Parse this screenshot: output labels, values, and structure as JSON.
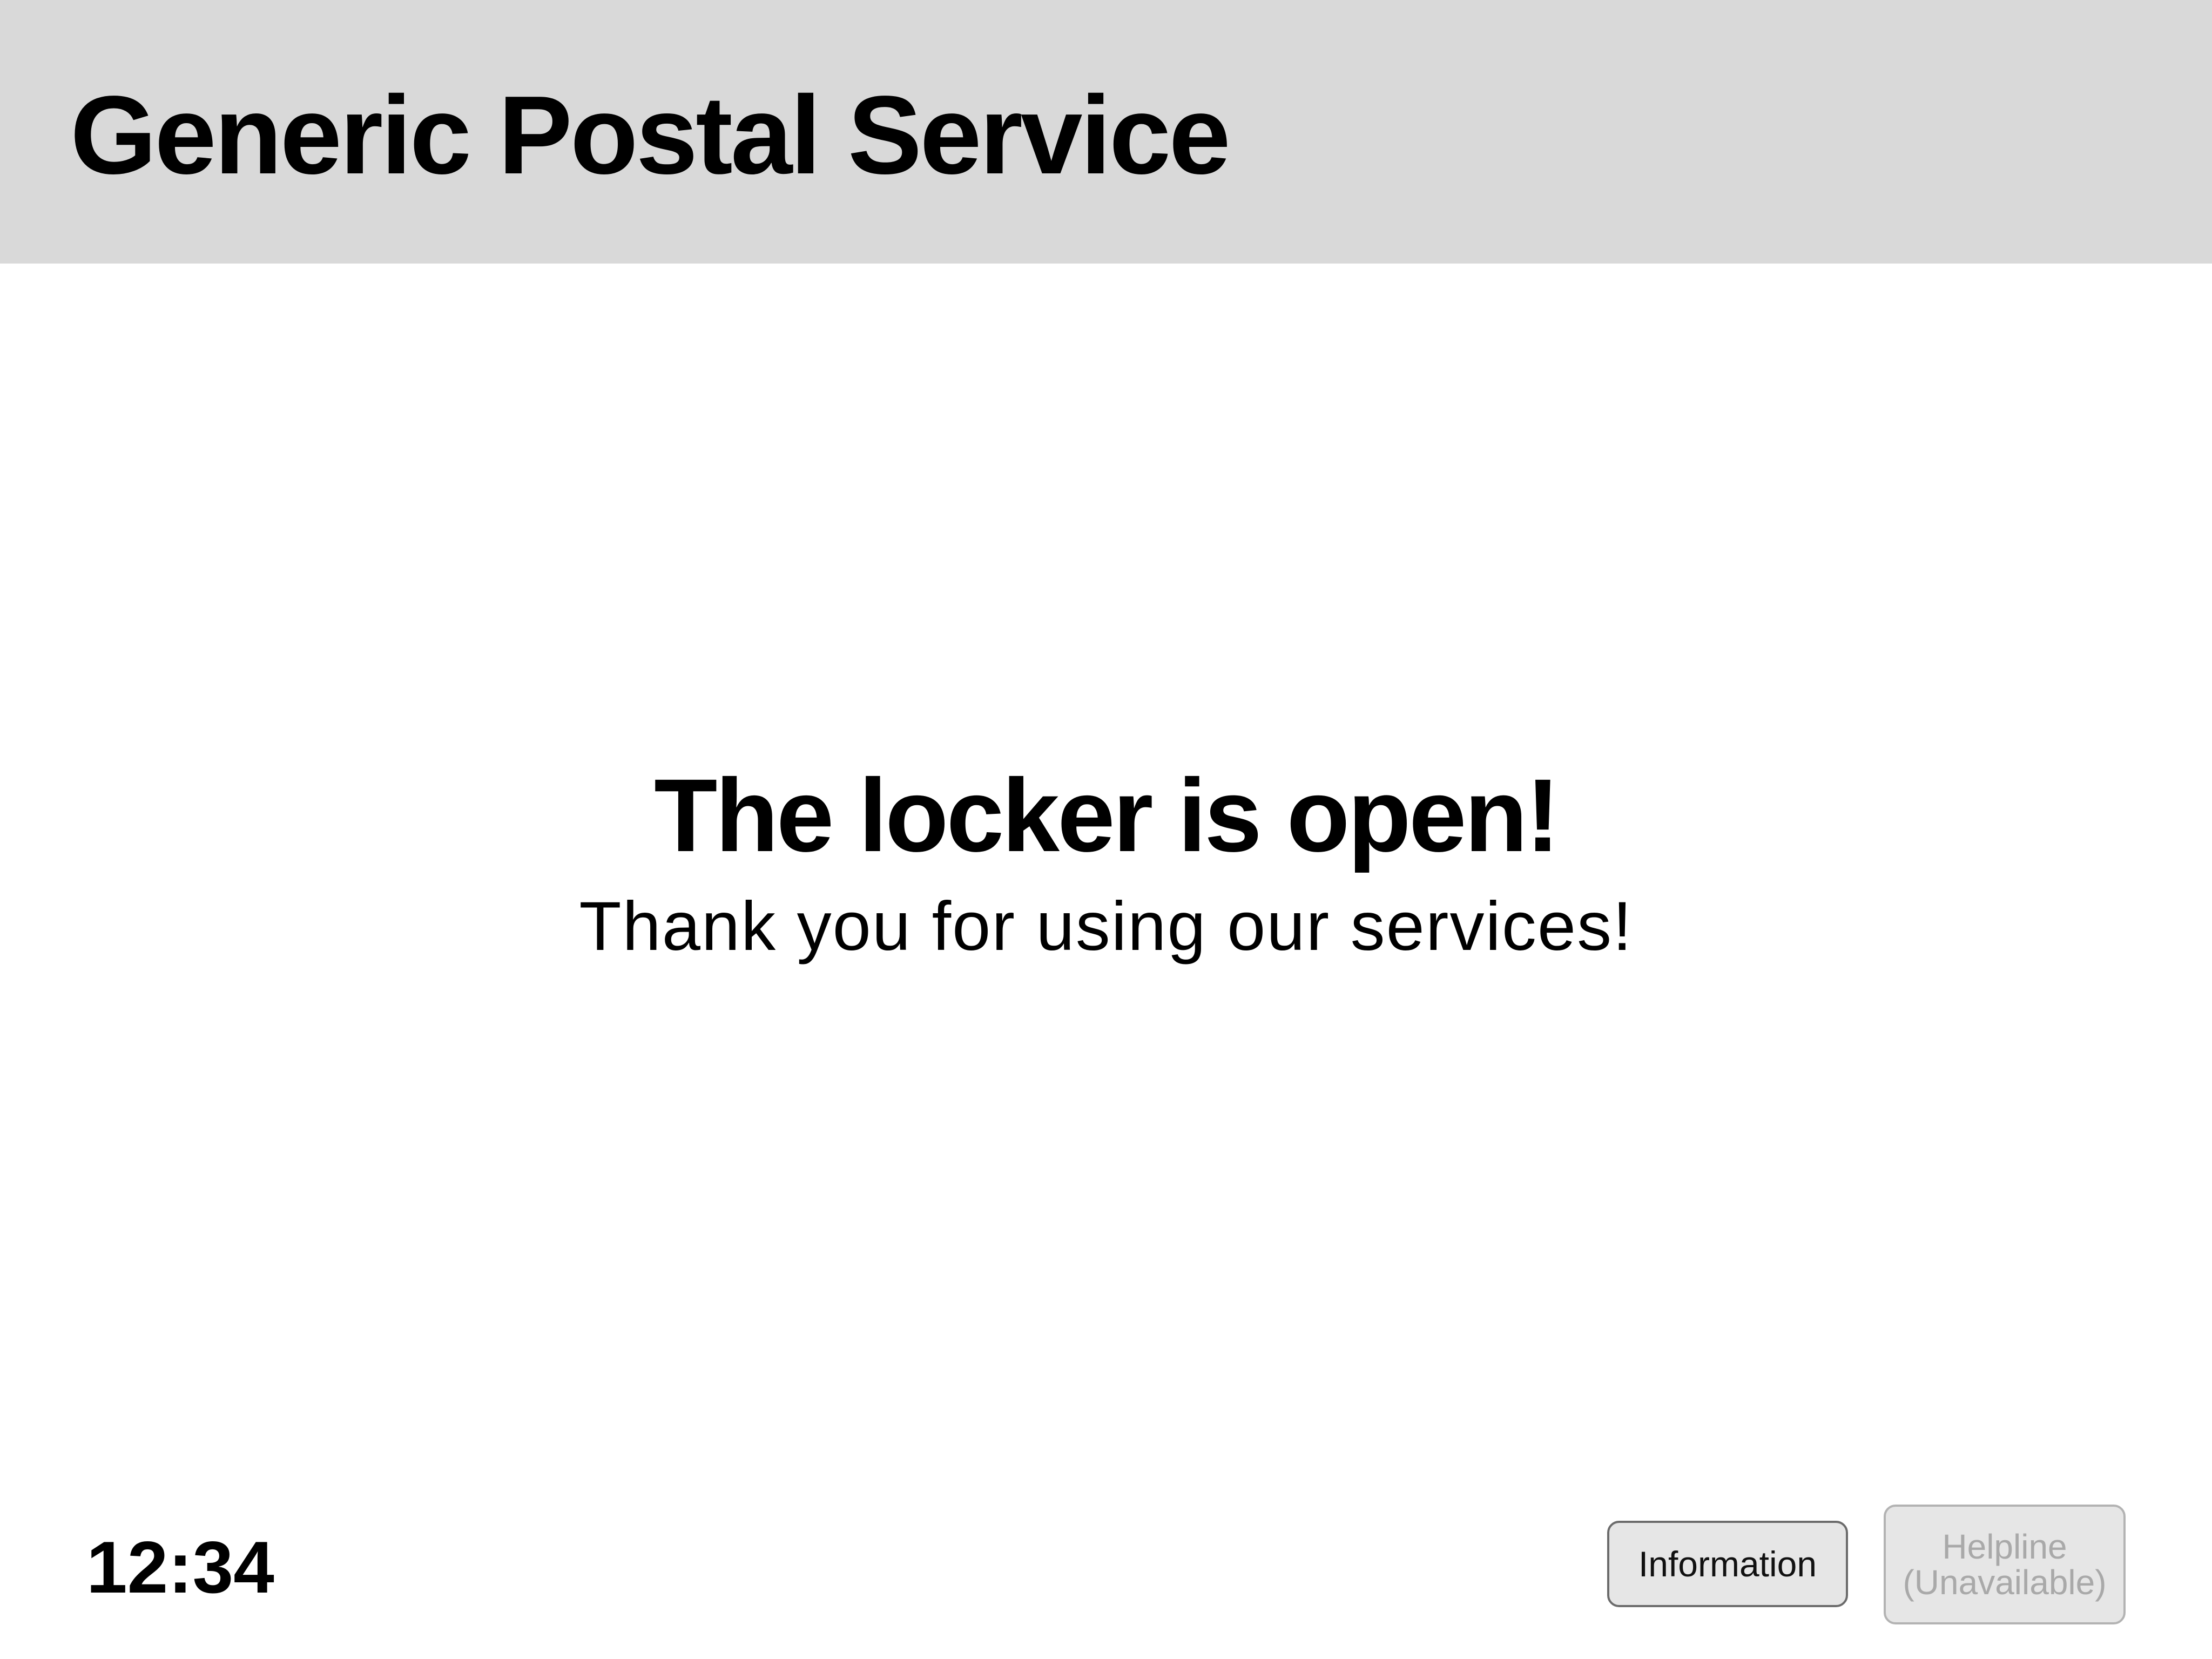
{
  "header": {
    "title": "Generic Postal Service"
  },
  "message": {
    "title": "The locker is open!",
    "subtitle": "Thank you for using our services!"
  },
  "status": {
    "clock": "12:34"
  },
  "footer": {
    "information_label": "Information",
    "helpline_label_line1": "Helpline",
    "helpline_label_line2": "(Unavailable)"
  },
  "colors": {
    "header_background": "#d9d9d9",
    "button_background": "#e6e6e6",
    "disabled_text": "#a9a9a9"
  }
}
